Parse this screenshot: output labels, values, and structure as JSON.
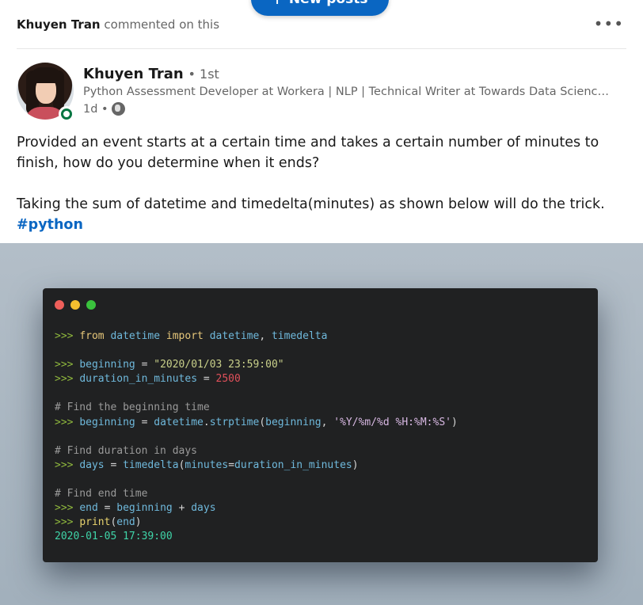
{
  "new_posts": {
    "label": "New posts",
    "icon": "arrow-up-icon"
  },
  "header": {
    "commenter": "Khuyen Tran",
    "action": "commented on this",
    "more_icon": "more-horizontal-icon"
  },
  "post": {
    "author": {
      "name": "Khuyen Tran",
      "degree": "• 1st",
      "headline": "Python Assessment Developer at Workera | NLP | Technical Writer at Towards Data Science ...",
      "time": "1d •",
      "visibility_icon": "globe-icon",
      "online": true
    },
    "text_line1": "Provided an event starts at a certain time and takes a certain number of minutes to finish, how do you determine when it ends?",
    "text_line2": "Taking the sum of datetime and timedelta(minutes) as shown below will do the trick.",
    "hashtag": "#python"
  },
  "code_image": {
    "window_dots": [
      "#ee5f5a",
      "#f6be2f",
      "#3ac23d"
    ],
    "lines": [
      [
        [
          "p",
          ">>> "
        ],
        [
          "k",
          "from "
        ],
        [
          "n",
          "datetime "
        ],
        [
          "k",
          "import "
        ],
        [
          "n",
          "datetime"
        ],
        [
          "o",
          ", "
        ],
        [
          "n",
          "timedelta"
        ]
      ],
      [],
      [
        [
          "p",
          ">>> "
        ],
        [
          "n",
          "beginning "
        ],
        [
          "o",
          "= "
        ],
        [
          "s",
          "\"2020/01/03 23:59:00\""
        ]
      ],
      [
        [
          "p",
          ">>> "
        ],
        [
          "n",
          "duration_in_minutes "
        ],
        [
          "o",
          "= "
        ],
        [
          "num",
          "2500"
        ]
      ],
      [],
      [
        [
          "c",
          "# Find the beginning time"
        ]
      ],
      [
        [
          "p",
          ">>> "
        ],
        [
          "n",
          "beginning "
        ],
        [
          "o",
          "= "
        ],
        [
          "n",
          "datetime"
        ],
        [
          "o",
          "."
        ],
        [
          "n",
          "strptime"
        ],
        [
          "o",
          "("
        ],
        [
          "n",
          "beginning"
        ],
        [
          "o",
          ", "
        ],
        [
          "sv",
          "'%Y/%m/%d %H:%M:%S'"
        ],
        [
          "o",
          ")"
        ]
      ],
      [],
      [
        [
          "c",
          "# Find duration in days"
        ]
      ],
      [
        [
          "p",
          ">>> "
        ],
        [
          "n",
          "days "
        ],
        [
          "o",
          "= "
        ],
        [
          "n",
          "timedelta"
        ],
        [
          "o",
          "("
        ],
        [
          "n",
          "minutes"
        ],
        [
          "o",
          "="
        ],
        [
          "n",
          "duration_in_minutes"
        ],
        [
          "o",
          ")"
        ]
      ],
      [],
      [
        [
          "c",
          "# Find end time"
        ]
      ],
      [
        [
          "p",
          ">>> "
        ],
        [
          "n",
          "end "
        ],
        [
          "o",
          "= "
        ],
        [
          "n",
          "beginning "
        ],
        [
          "o",
          "+ "
        ],
        [
          "n",
          "days"
        ]
      ],
      [
        [
          "p",
          ">>> "
        ],
        [
          "f",
          "print"
        ],
        [
          "o",
          "("
        ],
        [
          "n",
          "end"
        ],
        [
          "o",
          ")"
        ]
      ],
      [
        [
          "out",
          "2020-01-05 17:39:00"
        ]
      ]
    ]
  }
}
